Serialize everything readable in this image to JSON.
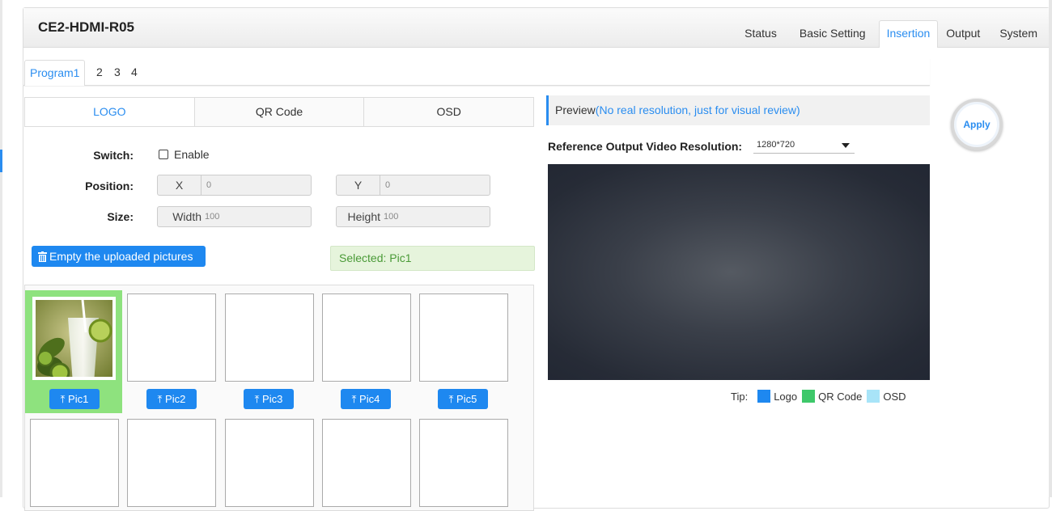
{
  "device_name": "CE2-HDMI-R05",
  "nav": [
    {
      "label": "Status",
      "active": false
    },
    {
      "label": "Basic Setting",
      "active": false
    },
    {
      "label": "Insertion",
      "active": true
    },
    {
      "label": "Output",
      "active": false
    },
    {
      "label": "System",
      "active": false
    }
  ],
  "programs": [
    "Program1",
    "2",
    "3",
    "4"
  ],
  "subtabs": [
    "LOGO",
    "QR Code",
    "OSD"
  ],
  "form": {
    "switch_label": "Switch:",
    "enable_label": "Enable",
    "enable_checked": false,
    "position_label": "Position:",
    "x_label": "X",
    "x_value": "0",
    "y_label": "Y",
    "y_value": "0",
    "size_label": "Size:",
    "width_label": "Width",
    "width_value": "100",
    "height_label": "Height",
    "height_value": "100"
  },
  "empty_button": "Empty the uploaded pictures",
  "selected_text": "Selected: Pic1",
  "pics": [
    "Pic1",
    "Pic2",
    "Pic3",
    "Pic4",
    "Pic5"
  ],
  "preview": {
    "title": "Preview",
    "note": "(No real resolution, just for visual review)",
    "ref_label": "Reference Output Video Resolution:",
    "resolution": "1280*720"
  },
  "apply_label": "Apply",
  "legend": {
    "tip": "Tip:",
    "items": [
      {
        "label": "Logo",
        "color": "#1e88f0"
      },
      {
        "label": "QR Code",
        "color": "#3ec86a"
      },
      {
        "label": "OSD",
        "color": "#a8e4f8"
      }
    ]
  }
}
